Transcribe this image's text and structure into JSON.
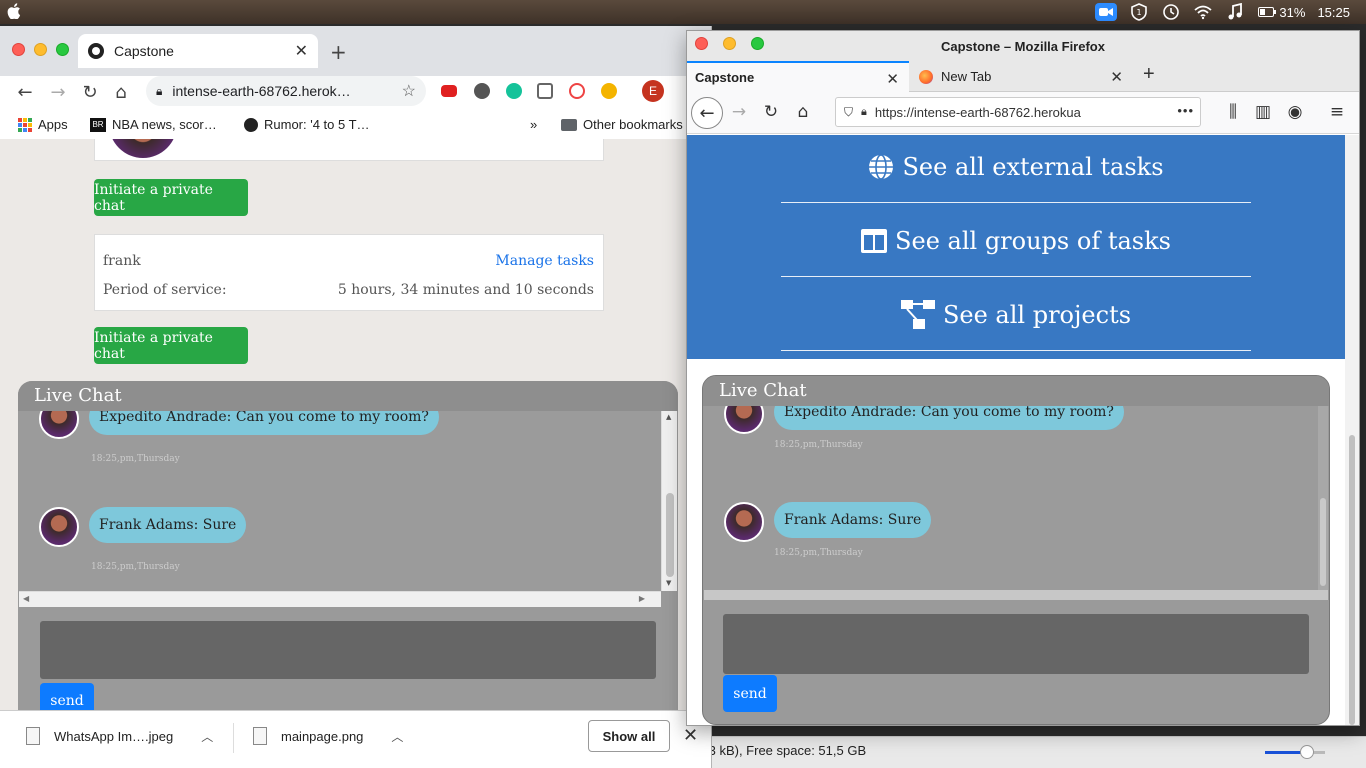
{
  "system": {
    "battery_percent": "31%",
    "clock": "15:25"
  },
  "finder_strip": {
    "free_space_text": ",3 kB), Free space: 51,5 GB",
    "zoom_level": 0.7
  },
  "chrome": {
    "tab_title": "Capstone",
    "address": "intense-earth-68762.herok…",
    "bookmarks": [
      {
        "label": "Apps"
      },
      {
        "label": "NBA news, scor…"
      },
      {
        "label": "Rumor: '4 to 5 T…"
      },
      {
        "label": "»"
      },
      {
        "label": "Other bookmarks"
      }
    ],
    "profile_letter": "E",
    "page": {
      "initiate_button_1": "Initiate a private chat",
      "user_card": {
        "name": "frank",
        "manage_link": "Manage tasks",
        "period_label": "Period of service:",
        "period_value": "5 hours, 34 minutes and 10 seconds"
      },
      "initiate_button_2": "Initiate a private chat"
    },
    "live_chat": {
      "title": "Live Chat",
      "messages": [
        {
          "text": "Expedito Andrade: Can you come to my room?",
          "time": "18:25,pm,Thursday"
        },
        {
          "text": "Frank Adams: Sure",
          "time": "18:25,pm,Thursday"
        }
      ],
      "send_label": "send"
    },
    "downloads": {
      "files": [
        {
          "name": "WhatsApp Im….jpeg"
        },
        {
          "name": "mainpage.png"
        }
      ],
      "show_all": "Show all",
      "close": "✕"
    }
  },
  "firefox": {
    "window_title": "Capstone – Mozilla Firefox",
    "tabs": [
      {
        "label": "Capstone"
      },
      {
        "label": "New Tab"
      }
    ],
    "url": "https://intense-earth-68762.herokua",
    "url_more": "•••",
    "nav_links": [
      {
        "label": "See all external tasks",
        "icon": "globe-icon"
      },
      {
        "label": "See all groups of tasks",
        "icon": "columns-icon"
      },
      {
        "label": "See all projects",
        "icon": "project-diagram-icon"
      }
    ],
    "live_chat": {
      "title": "Live Chat",
      "messages": [
        {
          "text": "Expedito Andrade: Can you come to my room?",
          "time": "18:25,pm,Thursday"
        },
        {
          "text": "Frank Adams: Sure",
          "time": "18:25,pm,Thursday"
        }
      ],
      "send_label": "send"
    }
  },
  "colors": {
    "nav_blue": "#3878c3",
    "green_button": "#28a745",
    "send_blue": "#0d7bff",
    "bubble": "#7ec8db",
    "chat_panel": "#9a9a9a"
  }
}
